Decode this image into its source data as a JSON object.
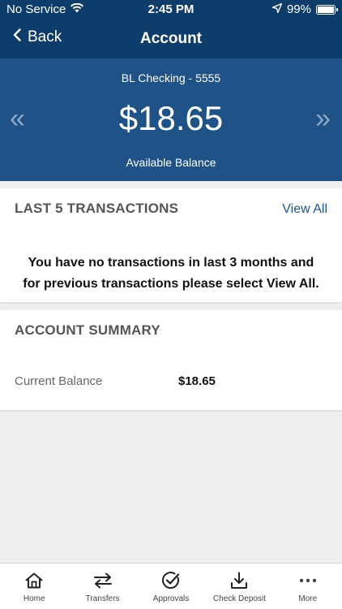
{
  "status": {
    "carrier": "No Service",
    "time": "2:45 PM",
    "battery": "99%"
  },
  "nav": {
    "back_label": "Back",
    "title": "Account"
  },
  "account": {
    "name": "BL Checking - 5555",
    "balance": "$18.65",
    "balance_label": "Available Balance",
    "prev_glyph": "«",
    "next_glyph": "»"
  },
  "transactions": {
    "title": "LAST 5 TRANSACTIONS",
    "view_all": "View All",
    "empty_message_line1": "You have no transactions in last 3 months and",
    "empty_message_line2": "for previous transactions please select View All."
  },
  "summary": {
    "title": "ACCOUNT SUMMARY",
    "current_balance_label": "Current Balance",
    "current_balance_value": "$18.65"
  },
  "tabs": [
    {
      "label": "Home",
      "icon": "home-icon"
    },
    {
      "label": "Transfers",
      "icon": "transfers-icon"
    },
    {
      "label": "Approvals",
      "icon": "approvals-icon"
    },
    {
      "label": "Check Deposit",
      "icon": "check-deposit-icon"
    },
    {
      "label": "More",
      "icon": "more-icon"
    }
  ],
  "colors": {
    "header": "#0f3d6b",
    "balance_panel": "#1f5287",
    "link": "#1f5287",
    "background": "#efefef"
  }
}
